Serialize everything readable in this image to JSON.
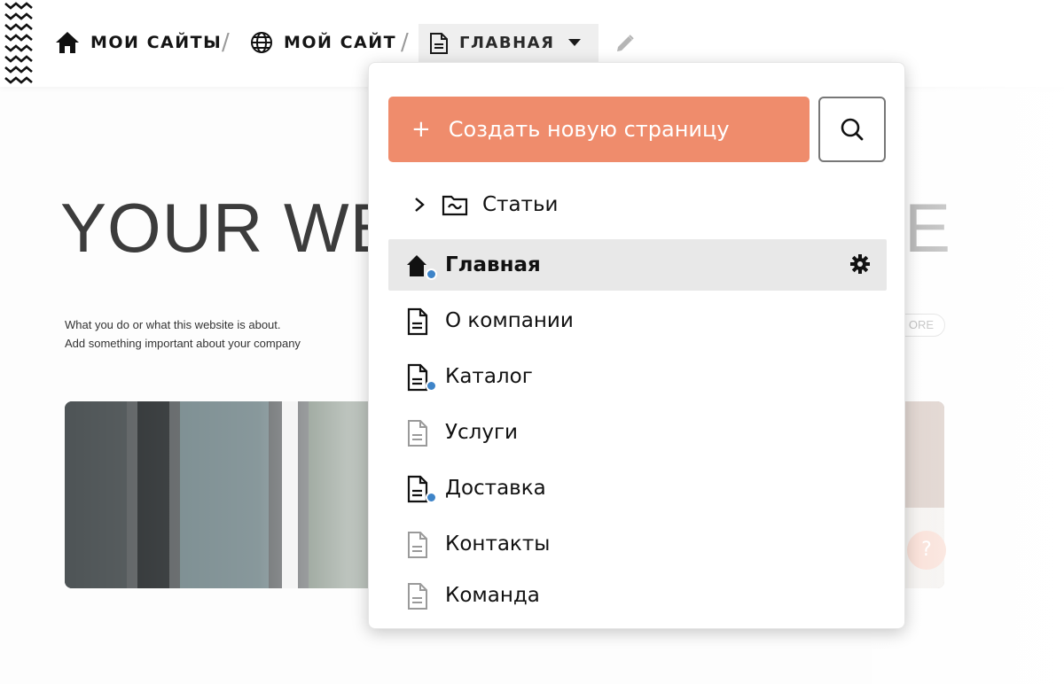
{
  "breadcrumb": {
    "sites_label": "МОИ САЙТЫ",
    "site_label": "МОЙ САЙТ",
    "separator": "/",
    "current_page": "ГЛАВНАЯ"
  },
  "website": {
    "hero_title_left": "YOUR WE",
    "hero_title_right": "E",
    "about_line1": "What you do or what this website is about.",
    "about_line2": "Add something important about your company",
    "more_label": "ORE",
    "help_label": "?"
  },
  "dropdown": {
    "create_label": "Создать новую страницу",
    "create_plus": "+",
    "folder": {
      "label": "Статьи",
      "expanded": false
    },
    "pages": [
      {
        "label": "Главная",
        "icon": "home-icon",
        "active": true,
        "published_dot": true,
        "muted": false
      },
      {
        "label": "О компании",
        "icon": "page-icon",
        "active": false,
        "published_dot": false,
        "muted": false
      },
      {
        "label": "Каталог",
        "icon": "page-icon",
        "active": false,
        "published_dot": true,
        "muted": false
      },
      {
        "label": "Услуги",
        "icon": "page-icon",
        "active": false,
        "published_dot": false,
        "muted": true
      },
      {
        "label": "Доставка",
        "icon": "page-icon",
        "active": false,
        "published_dot": true,
        "muted": false
      },
      {
        "label": "Контакты",
        "icon": "page-icon",
        "active": false,
        "published_dot": false,
        "muted": true
      },
      {
        "label": "Команда",
        "icon": "page-icon",
        "active": false,
        "published_dot": false,
        "muted": true
      }
    ]
  },
  "colors": {
    "accent": "#ef8c6c",
    "dot": "#3e84c8",
    "active_row": "#e8e8e8"
  }
}
